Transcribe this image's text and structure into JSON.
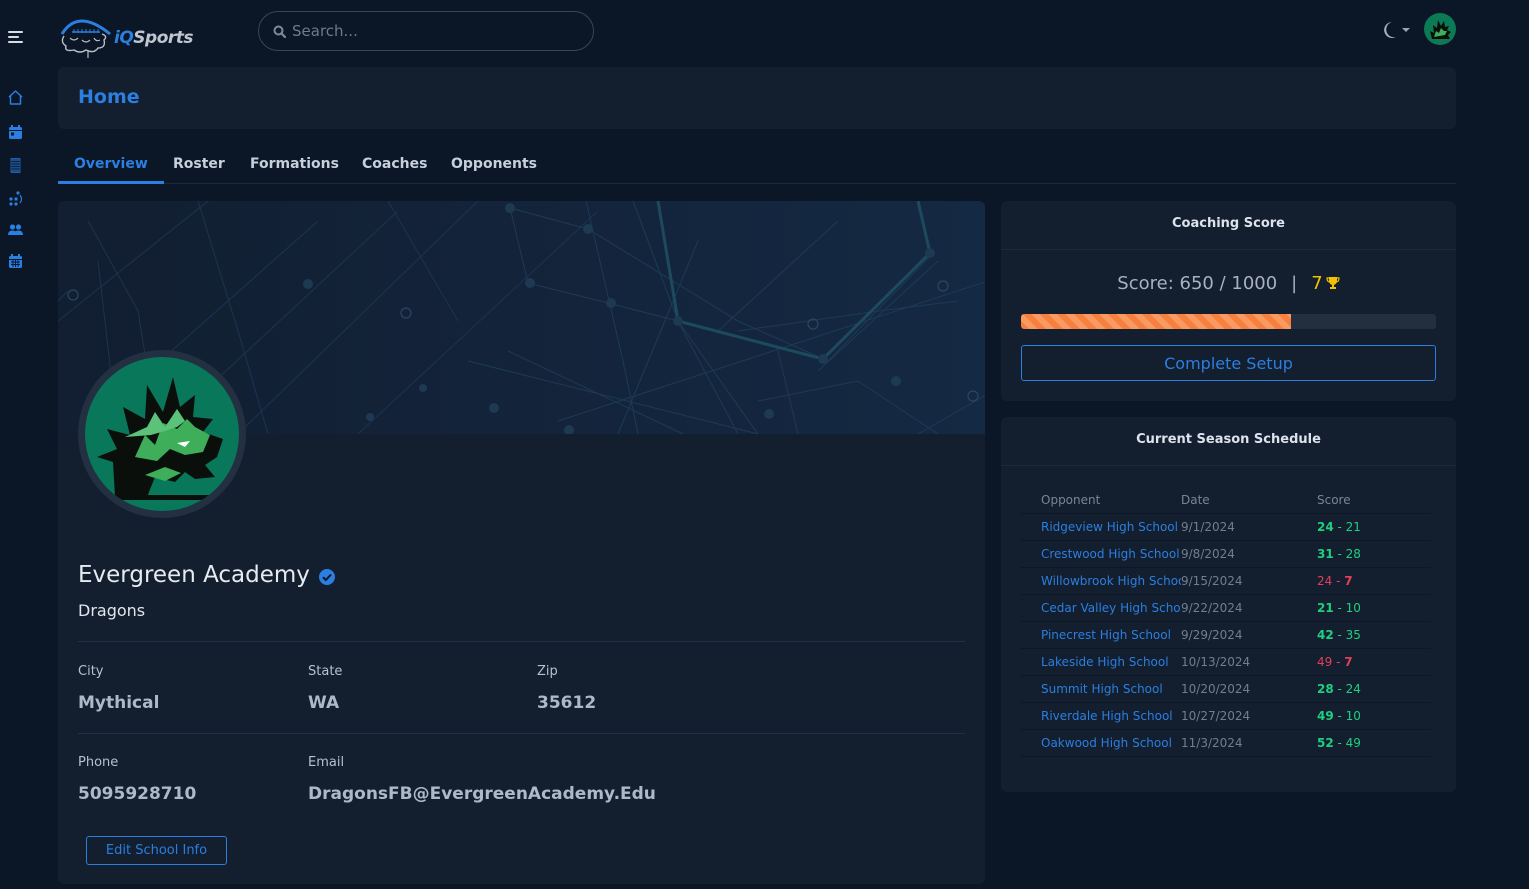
{
  "app": {
    "brand": {
      "prefix": "iQ",
      "suffix": "Sports"
    },
    "search": {
      "placeholder": "Search..."
    },
    "theme_icon": "moon-icon",
    "user_avatar": "dragon-logo"
  },
  "sidebar": {
    "items": [
      {
        "name": "home",
        "icon": "home-icon"
      },
      {
        "name": "calendar",
        "icon": "calendar-icon"
      },
      {
        "name": "playbook",
        "icon": "field-icon"
      },
      {
        "name": "formations",
        "icon": "formation-icon"
      },
      {
        "name": "team",
        "icon": "users-icon"
      },
      {
        "name": "schedule",
        "icon": "calendar-grid-icon"
      }
    ]
  },
  "header": {
    "title": "Home"
  },
  "tabs": [
    {
      "label": "Overview",
      "active": true
    },
    {
      "label": "Roster",
      "active": false
    },
    {
      "label": "Formations",
      "active": false
    },
    {
      "label": "Coaches",
      "active": false
    },
    {
      "label": "Opponents",
      "active": false
    }
  ],
  "school": {
    "name": "Evergreen Academy",
    "verified": true,
    "mascot": "Dragons",
    "fields": {
      "city": {
        "label": "City",
        "value": "Mythical"
      },
      "state": {
        "label": "State",
        "value": "WA"
      },
      "zip": {
        "label": "Zip",
        "value": "35612"
      },
      "phone": {
        "label": "Phone",
        "value": "5095928710"
      },
      "email": {
        "label": "Email",
        "value": "DragonsFB@EvergreenAcademy.Edu"
      }
    },
    "edit_label": "Edit School Info"
  },
  "coaching_score": {
    "title": "Coaching Score",
    "score_text": "Score: 650 / 1000",
    "separator": "|",
    "score": 650,
    "max": 1000,
    "progress_fraction": 0.65,
    "trophies": "7",
    "complete_label": "Complete Setup",
    "colors": {
      "progress": "#f7803e",
      "trophy": "#f2c200"
    }
  },
  "schedule": {
    "title": "Current Season Schedule",
    "columns": [
      "Opponent",
      "Date",
      "Score"
    ],
    "rows": [
      {
        "opponent": "Ridgeview High School",
        "date": "9/1/2024",
        "us": "24",
        "dash": " - ",
        "them": "21",
        "result": "win"
      },
      {
        "opponent": "Crestwood High School",
        "date": "9/8/2024",
        "us": "31",
        "dash": " - ",
        "them": "28",
        "result": "win"
      },
      {
        "opponent": "Willowbrook High School",
        "date": "9/15/2024",
        "us": "24",
        "dash": " - ",
        "them": "7",
        "result": "loss"
      },
      {
        "opponent": "Cedar Valley High School",
        "date": "9/22/2024",
        "us": "21",
        "dash": " - ",
        "them": "10",
        "result": "win"
      },
      {
        "opponent": "Pinecrest High School",
        "date": "9/29/2024",
        "us": "42",
        "dash": " - ",
        "them": "35",
        "result": "win"
      },
      {
        "opponent": "Lakeside High School",
        "date": "10/13/2024",
        "us": "49",
        "dash": " - ",
        "them": "7",
        "result": "loss"
      },
      {
        "opponent": "Summit High School",
        "date": "10/20/2024",
        "us": "28",
        "dash": " - ",
        "them": "24",
        "result": "win"
      },
      {
        "opponent": "Riverdale High School",
        "date": "10/27/2024",
        "us": "49",
        "dash": " - ",
        "them": "10",
        "result": "win"
      },
      {
        "opponent": "Oakwood High School",
        "date": "11/3/2024",
        "us": "52",
        "dash": " - ",
        "them": "49",
        "result": "win"
      }
    ],
    "colors": {
      "win": "#1fcf80",
      "loss": "#e0405a",
      "link": "#2b7fe0"
    }
  }
}
